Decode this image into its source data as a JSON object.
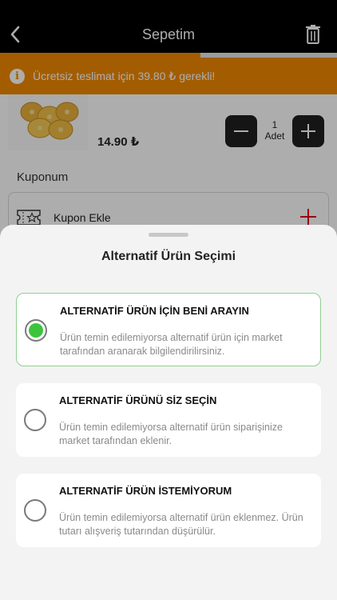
{
  "header": {
    "title": "Sepetim"
  },
  "shipping": {
    "progress": 0.595,
    "message": "Ücretsiz teslimat için 39.80 ₺ gerekli!"
  },
  "product": {
    "price": "14.90 ₺",
    "quantity": "1",
    "unit": "Adet"
  },
  "coupon": {
    "section_title": "Kuponum",
    "add_label": "Kupon Ekle"
  },
  "sheet": {
    "title": "Alternatif Ürün Seçimi",
    "options": [
      {
        "title": "ALTERNATİF ÜRÜN İÇİN BENİ ARAYIN",
        "description": "Ürün temin edilemiyorsa alternatif ürün için market tarafından aranarak bilgilendirilirsiniz.",
        "selected": true
      },
      {
        "title": "ALTERNATİF ÜRÜNÜ SİZ SEÇİN",
        "description": "Ürün temin edilemiyorsa alternatif ürün siparişinize market tarafından eklenir.",
        "selected": false
      },
      {
        "title": "ALTERNATİF ÜRÜN İSTEMİYORUM",
        "description": "Ürün temin edilemiyorsa alternatif ürün eklenmez. Ürün tutarı alışveriş tutarından düşürülür.",
        "selected": false
      }
    ]
  },
  "colors": {
    "accent": "#F08A00",
    "selected": "#3DC43D",
    "danger": "#E2001A"
  },
  "icons": {
    "back": "chevron-left-icon",
    "delete": "trash-icon",
    "info": "info-icon",
    "coupon": "ticket-star-icon",
    "add": "plus-icon",
    "decrease": "minus-icon"
  }
}
